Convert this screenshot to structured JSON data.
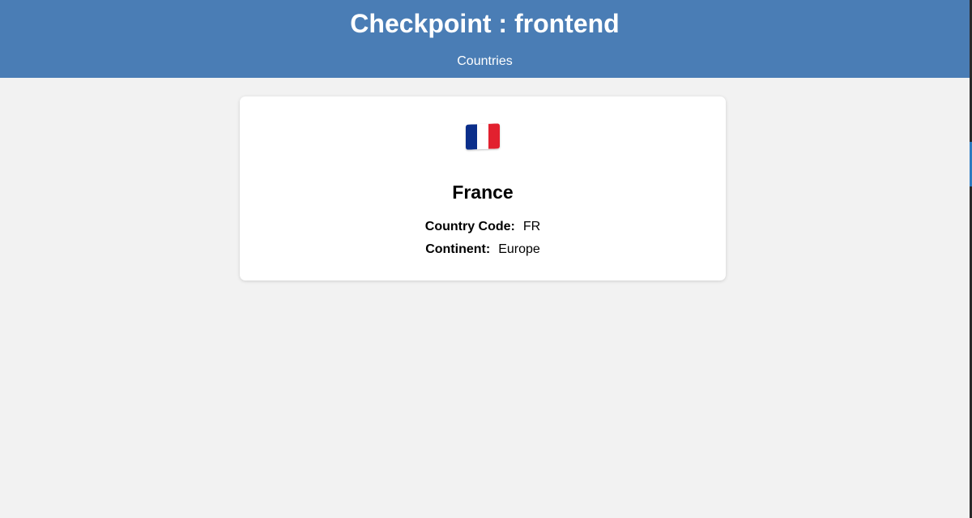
{
  "header": {
    "title": "Checkpoint : frontend",
    "nav_link": "Countries"
  },
  "country": {
    "flag_icon": "france-flag-icon",
    "flag_colors": [
      "#0b2e8a",
      "#ffffff",
      "#e2212f"
    ],
    "name": "France",
    "code_label": "Country Code:",
    "code_value": "FR",
    "continent_label": "Continent:",
    "continent_value": "Europe"
  },
  "colors": {
    "header_bg": "#4a7db5",
    "page_bg": "#f2f2f2",
    "card_bg": "#ffffff"
  }
}
